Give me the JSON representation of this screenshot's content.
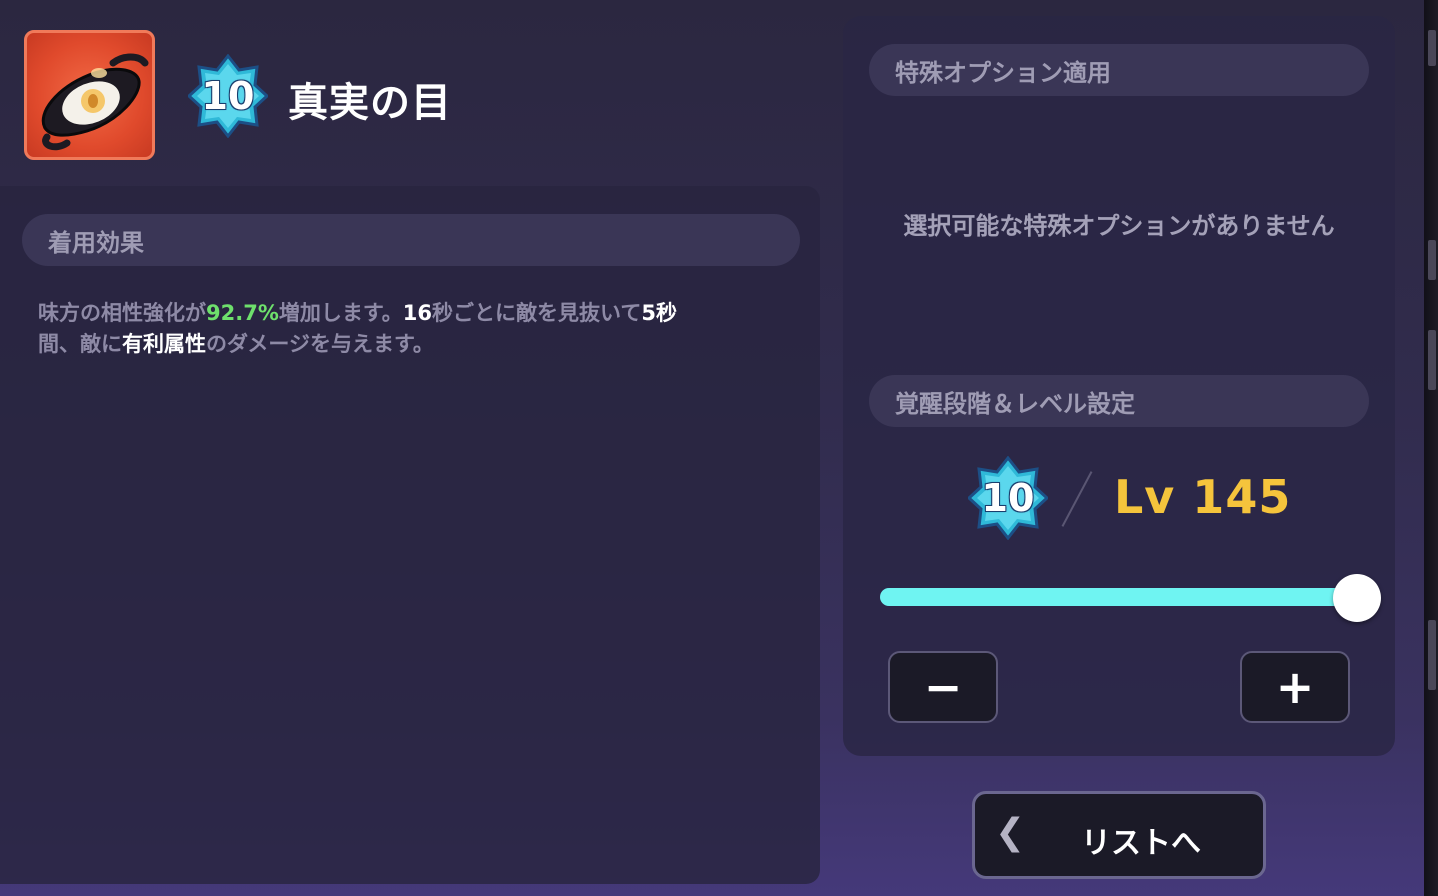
{
  "item": {
    "title": "真実の目",
    "icon": "eye-of-truth-icon",
    "awakening_stage": "10"
  },
  "left_panel": {
    "header": "着用効果",
    "effect_parts": [
      {
        "text": "味方の相性強化が",
        "style": "normal"
      },
      {
        "text": "92.7%",
        "style": "green"
      },
      {
        "text": "増加します。",
        "style": "normal"
      },
      {
        "text": "16",
        "style": "white"
      },
      {
        "text": "秒ごとに敵を見抜いて",
        "style": "normal"
      },
      {
        "text": "5秒",
        "style": "white"
      },
      {
        "text": "間、敵に",
        "style": "normal"
      },
      {
        "text": "有利属性",
        "style": "white"
      },
      {
        "text": "のダメージを与えます。",
        "style": "normal"
      }
    ]
  },
  "right_panel": {
    "special_option_header": "特殊オプション適用",
    "no_option_text": "選択可能な特殊オプションがありません",
    "awaken_level_header": "覚醒段階＆レベル設定",
    "awakening_stage": "10",
    "level_label": "Lv 145",
    "slider_fraction": 1.0,
    "minus_label": "−",
    "plus_label": "+"
  },
  "footer": {
    "list_button_label": "リストへ",
    "back_icon": "chevron-left-icon"
  },
  "colors": {
    "accent_cyan": "#6ff4f2",
    "level_gold": "#f5c43c",
    "highlight_green": "#6ee06c"
  }
}
